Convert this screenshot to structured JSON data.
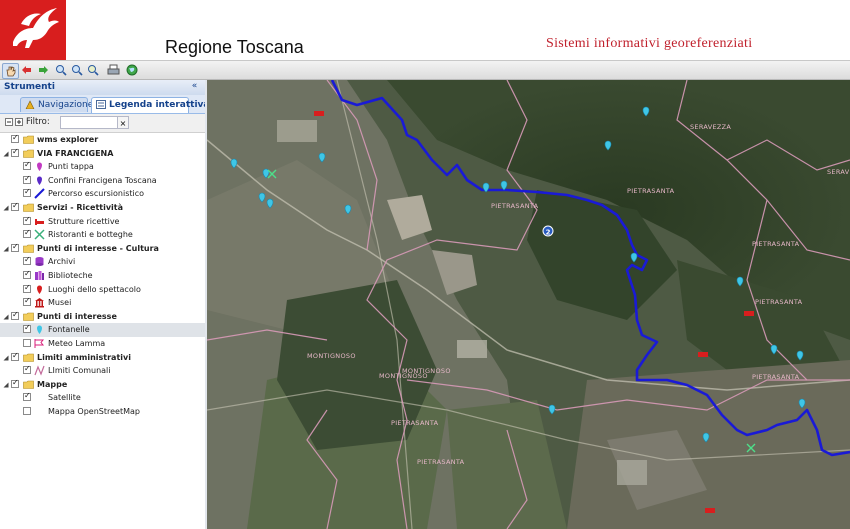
{
  "header": {
    "title": "Regione Toscana",
    "subtitle": "Sistemi informativi georeferenziati"
  },
  "toolbar": {
    "tools": [
      "pan-icon",
      "back-icon",
      "forward-icon",
      "zoom-in-icon",
      "zoom-out-icon",
      "zoom-extent-icon",
      "print-icon",
      "globe-icon"
    ]
  },
  "sidebar": {
    "title": "Strumenti",
    "collapse": "«",
    "tabs": [
      {
        "label": "Navigazione",
        "active": false
      },
      {
        "label": "Legenda interattiva",
        "active": true
      }
    ],
    "filter": {
      "label": "Filtro:",
      "value": "",
      "clear": "×"
    },
    "items": [
      {
        "label": "wms explorer",
        "level": 0,
        "type": "group",
        "checked": true,
        "expand": false
      },
      {
        "label": "VIA FRANCIGENA",
        "level": 0,
        "type": "group",
        "checked": true,
        "expand": true
      },
      {
        "label": "Punti tappa",
        "level": 1,
        "type": "layer",
        "checked": true,
        "icon": "pin-magenta"
      },
      {
        "label": "Confini Francigena Toscana",
        "level": 1,
        "type": "layer",
        "checked": true,
        "icon": "pin-purple"
      },
      {
        "label": "Percorso escursionistico",
        "level": 1,
        "type": "layer",
        "checked": true,
        "icon": "line-blue"
      },
      {
        "label": "Servizi - Ricettività",
        "level": 0,
        "type": "group",
        "checked": true,
        "expand": true
      },
      {
        "label": "Strutture ricettive",
        "level": 1,
        "type": "layer",
        "checked": true,
        "icon": "bed"
      },
      {
        "label": "Ristoranti e botteghe",
        "level": 1,
        "type": "layer",
        "checked": true,
        "icon": "cutlery"
      },
      {
        "label": "Punti di interesse - Cultura",
        "level": 0,
        "type": "group",
        "checked": true,
        "expand": true
      },
      {
        "label": "Archivi",
        "level": 1,
        "type": "layer",
        "checked": true,
        "icon": "database"
      },
      {
        "label": "Biblioteche",
        "level": 1,
        "type": "layer",
        "checked": true,
        "icon": "books"
      },
      {
        "label": "Luoghi dello spettacolo",
        "level": 1,
        "type": "layer",
        "checked": true,
        "icon": "pin-red"
      },
      {
        "label": "Musei",
        "level": 1,
        "type": "layer",
        "checked": true,
        "icon": "museum"
      },
      {
        "label": "Punti di interesse",
        "level": 0,
        "type": "group",
        "checked": true,
        "expand": true
      },
      {
        "label": "Fontanelle",
        "level": 1,
        "type": "layer",
        "checked": true,
        "icon": "pin-cyan",
        "selected": true
      },
      {
        "label": "Meteo Lamma",
        "level": 1,
        "type": "layer",
        "checked": false,
        "icon": "flag"
      },
      {
        "label": "Limiti amministrativi",
        "level": 0,
        "type": "group",
        "checked": true,
        "expand": true
      },
      {
        "label": "LImiti Comunali",
        "level": 1,
        "type": "layer",
        "checked": true,
        "icon": "line-pink"
      },
      {
        "label": "Mappe",
        "level": 0,
        "type": "group",
        "checked": true,
        "expand": true
      },
      {
        "label": "Satellite",
        "level": 1,
        "type": "layer",
        "checked": true,
        "icon": "none"
      },
      {
        "label": "Mappa OpenStreetMap",
        "level": 1,
        "type": "layer",
        "checked": false,
        "icon": "none"
      }
    ]
  },
  "map": {
    "labels": [
      "SERAVEZZA",
      "SERAVEZZA",
      "PIETRASANTA",
      "PIETRASANTA",
      "PIETRASANTA",
      "PIETRASANTA",
      "PIETRASANTA",
      "MONTIGNOSO",
      "MONTIGNOSO",
      "MONTIGNOSO",
      "PIETRASANTA",
      "PIETRASANTA"
    ],
    "route_marker": "2",
    "colors": {
      "route": "#1a1ad6",
      "boundary": "#d89ab8",
      "fountain": "#3fc6e6",
      "accent": "#d81e1e"
    }
  }
}
